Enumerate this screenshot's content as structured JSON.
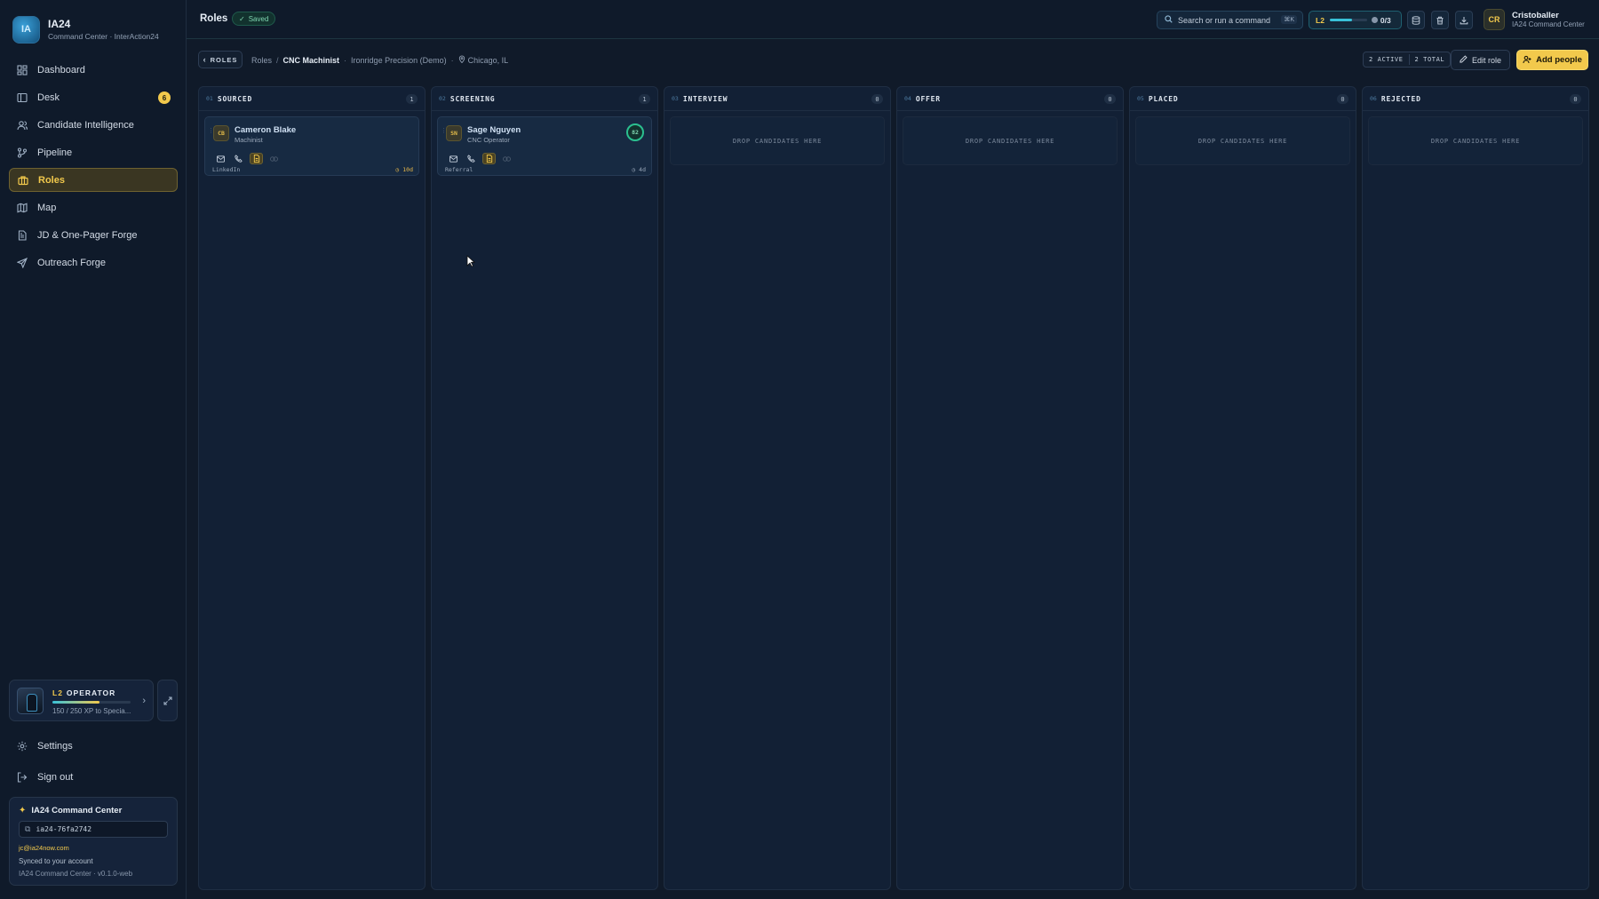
{
  "brand": {
    "logo": "IA",
    "name": "IA24",
    "subtitle": "Command Center · InterAction24"
  },
  "nav": [
    {
      "label": "Dashboard",
      "icon": "dashboard-icon"
    },
    {
      "label": "Desk",
      "icon": "desk-icon",
      "badge": "6"
    },
    {
      "label": "Candidate Intelligence",
      "icon": "users-icon"
    },
    {
      "label": "Pipeline",
      "icon": "pipeline-icon"
    },
    {
      "label": "Roles",
      "icon": "briefcase-icon",
      "active": true
    },
    {
      "label": "Map",
      "icon": "map-icon"
    },
    {
      "label": "JD & One-Pager Forge",
      "icon": "document-icon"
    },
    {
      "label": "Outreach Forge",
      "icon": "send-icon"
    }
  ],
  "operator": {
    "level": "L2",
    "title": "OPERATOR",
    "xp_text": "150 / 250 XP to Specia...",
    "progress": 0.6
  },
  "bottom_nav": {
    "settings": "Settings",
    "signout": "Sign out"
  },
  "command_center": {
    "title": "IA24 Command Center",
    "code": "ia24-76fa2742",
    "email": "jc@ia24now.com",
    "sync": "Synced to your account",
    "version": "IA24 Command Center · v0.1.0-web"
  },
  "topbar": {
    "title": "Roles",
    "saved": "Saved",
    "search_placeholder": "Search or run a command",
    "search_kbd": "⌘K",
    "level": "L2",
    "level_progress": 0.6,
    "count": "0/3",
    "user_initials": "CR",
    "user_name": "Cristoballer",
    "user_org": "IA24 Command Center"
  },
  "breadcrumb": {
    "back": "ROLES",
    "roles": "Roles",
    "role": "CNC Machinist",
    "company": "Ironridge Precision (Demo)",
    "location": "Chicago, IL"
  },
  "stats": {
    "active": "2 ACTIVE",
    "total": "2 TOTAL"
  },
  "actions": {
    "edit": "Edit role",
    "add": "Add people"
  },
  "drop_text": "DROP CANDIDATES HERE",
  "columns": [
    {
      "num": "01",
      "name": "SOURCED",
      "count": "1"
    },
    {
      "num": "02",
      "name": "SCREENING",
      "count": "1"
    },
    {
      "num": "03",
      "name": "INTERVIEW",
      "count": "0"
    },
    {
      "num": "04",
      "name": "OFFER",
      "count": "0"
    },
    {
      "num": "05",
      "name": "PLACED",
      "count": "0"
    },
    {
      "num": "06",
      "name": "REJECTED",
      "count": "0"
    }
  ],
  "cards": [
    {
      "initials": "CB",
      "name": "Cameron Blake",
      "title": "Machinist",
      "source": "LinkedIn",
      "age": "10d"
    },
    {
      "initials": "SN",
      "name": "Sage Nguyen",
      "title": "CNC Operator",
      "source": "Referral",
      "age": "4d",
      "score": "82"
    }
  ]
}
